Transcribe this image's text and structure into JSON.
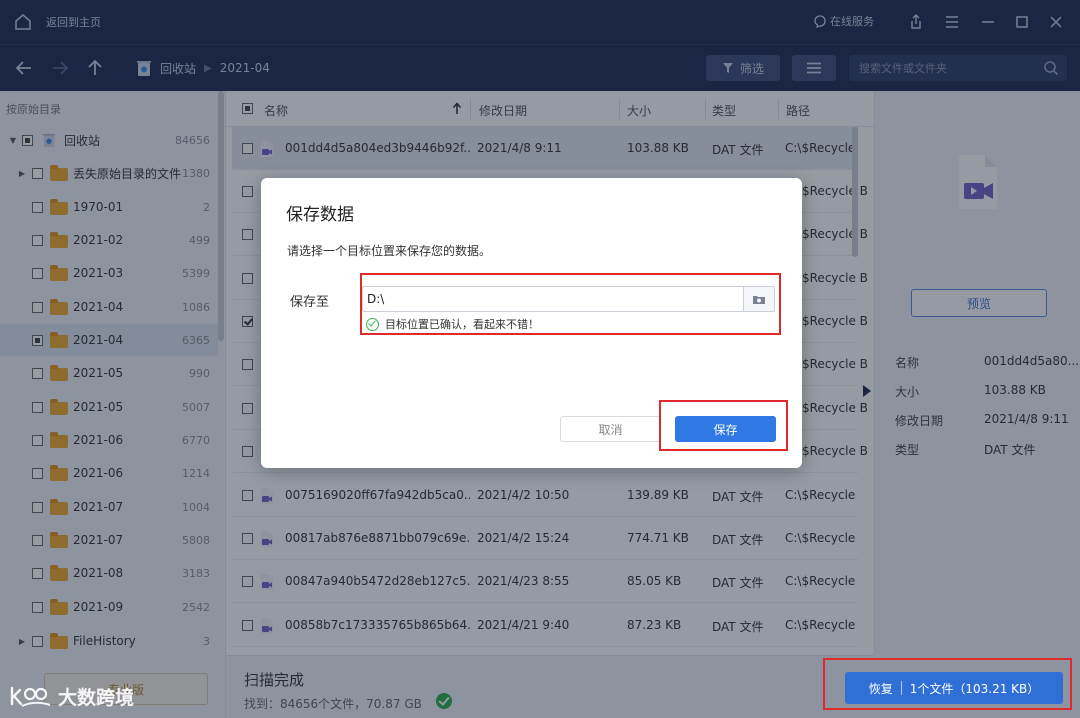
{
  "titlebar": {
    "home_label": "返回到主页",
    "online_service": "在线服务"
  },
  "nav": {
    "crumbs": [
      "回收站",
      "2021-04"
    ],
    "filter_label": "筛选",
    "search_placeholder": "搜索文件或文件夹"
  },
  "sidebar": {
    "header": "按原始目录",
    "items": [
      {
        "label": "回收站",
        "count": "84656"
      },
      {
        "label": "丢失原始目录的文件",
        "count": "1380"
      },
      {
        "label": "1970-01",
        "count": "2"
      },
      {
        "label": "2021-02",
        "count": "499"
      },
      {
        "label": "2021-03",
        "count": "5399"
      },
      {
        "label": "2021-04",
        "count": "1086"
      },
      {
        "label": "2021-04",
        "count": "6365"
      },
      {
        "label": "2021-05",
        "count": "990"
      },
      {
        "label": "2021-05",
        "count": "5007"
      },
      {
        "label": "2021-06",
        "count": "6770"
      },
      {
        "label": "2021-06",
        "count": "1214"
      },
      {
        "label": "2021-07",
        "count": "1004"
      },
      {
        "label": "2021-07",
        "count": "5808"
      },
      {
        "label": "2021-08",
        "count": "3183"
      },
      {
        "label": "2021-09",
        "count": "2542"
      },
      {
        "label": "FileHistory",
        "count": "3"
      }
    ],
    "pro_label": "专业版"
  },
  "list": {
    "columns": {
      "name": "名称",
      "date": "修改日期",
      "size": "大小",
      "type": "类型",
      "path": "路径"
    },
    "rows": [
      {
        "name": "001dd4d5a804ed3b9446b92f...",
        "date": "2021/4/8 9:11",
        "size": "103.88 KB",
        "type": "DAT 文件",
        "path": "C:\\$Recycle I"
      },
      {
        "name": "",
        "date": "",
        "size": "",
        "type": "",
        "path": "$Recycle B"
      },
      {
        "name": "",
        "date": "",
        "size": "",
        "type": "",
        "path": "$Recycle B"
      },
      {
        "name": "",
        "date": "",
        "size": "",
        "type": "",
        "path": "$Recycle B"
      },
      {
        "name": "",
        "date": "",
        "size": "",
        "type": "",
        "path": "$Recycle B"
      },
      {
        "name": "",
        "date": "",
        "size": "",
        "type": "",
        "path": "$Recycle B"
      },
      {
        "name": "",
        "date": "",
        "size": "",
        "type": "",
        "path": "$Recycle B"
      },
      {
        "name": "",
        "date": "",
        "size": "",
        "type": "",
        "path": "$Recycle B"
      },
      {
        "name": "0075169020ff67fa942db5ca0...",
        "date": "2021/4/2 10:50",
        "size": "139.89 KB",
        "type": "DAT 文件",
        "path": "C:\\$Recycle B"
      },
      {
        "name": "00817ab876e8871bb079c69e...",
        "date": "2021/4/2 15:24",
        "size": "774.71 KB",
        "type": "DAT 文件",
        "path": "C:\\$Recycle B"
      },
      {
        "name": "00847a940b5472d28eb127c5...",
        "date": "2021/4/23 8:55",
        "size": "85.05 KB",
        "type": "DAT 文件",
        "path": "C:\\$Recycle B"
      },
      {
        "name": "00858b7c173335765b865b64...",
        "date": "2021/4/21 9:40",
        "size": "87.23 KB",
        "type": "DAT 文件",
        "path": "C:\\$Recycle B"
      }
    ]
  },
  "status": {
    "title": "扫描完成",
    "found": "找到：84656个文件，70.87 GB"
  },
  "details": {
    "preview_label": "预览",
    "name_key": "名称",
    "name_val": "001dd4d5a80...",
    "size_key": "大小",
    "size_val": "103.88 KB",
    "date_key": "修改日期",
    "date_val": "2021/4/8 9:11",
    "type_key": "类型",
    "type_val": "DAT 文件"
  },
  "recover": {
    "label": "恢复",
    "info": "1个文件（103.21 KB）"
  },
  "dialog": {
    "title": "保存数据",
    "description": "请选择一个目标位置来保存您的数据。",
    "save_to_label": "保存至",
    "path_value": "D:\\",
    "validation": "目标位置已确认，看起来不错！",
    "cancel_label": "取消",
    "save_label": "保存"
  },
  "watermark": "大数跨境",
  "colors": {
    "dark_bar": "#1f2d52",
    "accent_blue": "#3078e3",
    "highlight_red": "#e0292b",
    "folder": "#f2a92a"
  }
}
